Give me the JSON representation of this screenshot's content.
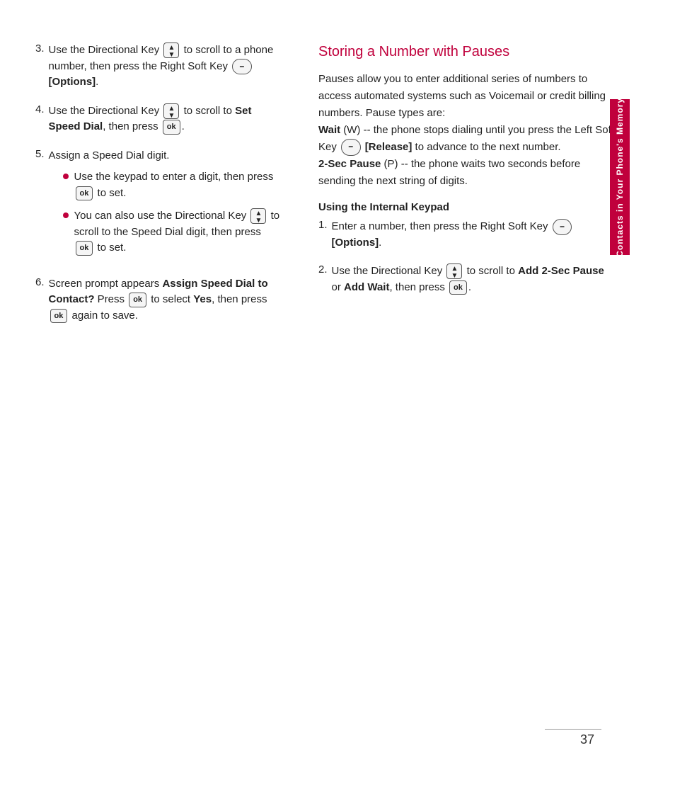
{
  "page": {
    "number": "37",
    "sidebar_label": "Contacts in Your Phone's Memory"
  },
  "left_col": {
    "items": [
      {
        "number": "3.",
        "text_parts": [
          {
            "text": "Use the Directional Key ",
            "bold": false
          },
          {
            "text": "dir_icon",
            "type": "icon_dir"
          },
          {
            "text": " to scroll to a phone number, then press the Right Soft Key ",
            "bold": false
          },
          {
            "text": "soft_icon",
            "type": "icon_soft"
          },
          {
            "text": " ",
            "bold": false
          },
          {
            "text": "[Options]",
            "bold": true
          },
          {
            "text": ".",
            "bold": false
          }
        ]
      },
      {
        "number": "4.",
        "text_parts": [
          {
            "text": "Use the Directional Key ",
            "bold": false
          },
          {
            "text": "dir_icon",
            "type": "icon_dir"
          },
          {
            "text": " to scroll to ",
            "bold": false
          },
          {
            "text": "Set Speed Dial",
            "bold": true
          },
          {
            "text": ", then press ",
            "bold": false
          },
          {
            "text": "ok_icon",
            "type": "icon_ok"
          },
          {
            "text": ".",
            "bold": false
          }
        ]
      },
      {
        "number": "5.",
        "text": "Assign a Speed Dial digit.",
        "bullets": [
          {
            "text_parts": [
              {
                "text": "Use the keypad to enter a digit, then press ",
                "bold": false
              },
              {
                "text": "ok_icon",
                "type": "icon_ok"
              },
              {
                "text": " to set.",
                "bold": false
              }
            ]
          },
          {
            "text_parts": [
              {
                "text": "You can also use the Directional Key ",
                "bold": false
              },
              {
                "text": "dir_icon",
                "type": "icon_dir"
              },
              {
                "text": " to scroll to the Speed Dial digit, then press ",
                "bold": false
              },
              {
                "text": "ok_icon",
                "type": "icon_ok"
              },
              {
                "text": " to set.",
                "bold": false
              }
            ]
          }
        ]
      },
      {
        "number": "6.",
        "text_parts": [
          {
            "text": "Screen prompt appears ",
            "bold": false
          },
          {
            "text": "Assign Speed Dial to Contact?",
            "bold": true
          },
          {
            "text": " Press ",
            "bold": false
          },
          {
            "text": "ok_icon",
            "type": "icon_ok"
          },
          {
            "text": " to select ",
            "bold": false
          },
          {
            "text": "Yes",
            "bold": true
          },
          {
            "text": ", then press ",
            "bold": false
          },
          {
            "text": "ok_icon",
            "type": "icon_ok"
          },
          {
            "text": " again to save.",
            "bold": false
          }
        ]
      }
    ]
  },
  "right_col": {
    "section_title": "Storing a Number with Pauses",
    "intro": "Pauses allow you to enter additional series of numbers to access automated systems such as Voicemail or credit billing numbers. Pause types are:",
    "pause_types": [
      {
        "label": "Wait",
        "label_extra": " (W)",
        "desc": " -- the phone stops dialing until you press the Left Soft Key ",
        "icon": "soft_icon",
        "icon2_label": "[Release]",
        "desc2": " to advance to the next number."
      },
      {
        "label": "2-Sec Pause",
        "label_extra": " (P)",
        "desc": " -- the phone waits two seconds before sending the next string of digits."
      }
    ],
    "subheading": "Using the Internal Keypad",
    "items": [
      {
        "number": "1.",
        "text_parts": [
          {
            "text": "Enter a number, then press the Right Soft Key ",
            "bold": false
          },
          {
            "text": "soft_icon",
            "type": "icon_soft"
          },
          {
            "text": " ",
            "bold": false
          },
          {
            "text": "[Options]",
            "bold": true
          },
          {
            "text": ".",
            "bold": false
          }
        ]
      },
      {
        "number": "2.",
        "text_parts": [
          {
            "text": "Use the Directional Key ",
            "bold": false
          },
          {
            "text": "dir_icon",
            "type": "icon_dir"
          },
          {
            "text": " to scroll to ",
            "bold": false
          },
          {
            "text": "Add 2-Sec Pause",
            "bold": true
          },
          {
            "text": " or ",
            "bold": false
          },
          {
            "text": "Add Wait",
            "bold": true
          },
          {
            "text": ", then press ",
            "bold": false
          },
          {
            "text": "ok_icon",
            "type": "icon_ok"
          },
          {
            "text": ".",
            "bold": false
          }
        ]
      }
    ]
  }
}
